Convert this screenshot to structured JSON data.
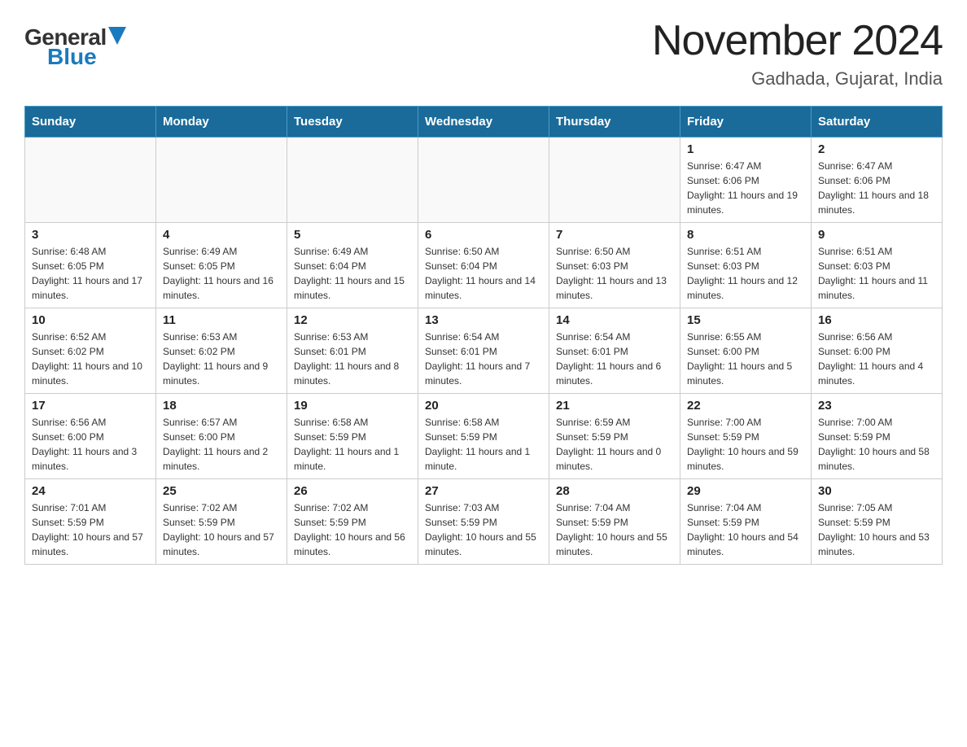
{
  "logo": {
    "general": "General",
    "blue": "Blue"
  },
  "title": "November 2024",
  "subtitle": "Gadhada, Gujarat, India",
  "weekdays": [
    "Sunday",
    "Monday",
    "Tuesday",
    "Wednesday",
    "Thursday",
    "Friday",
    "Saturday"
  ],
  "weeks": [
    [
      {
        "day": "",
        "info": ""
      },
      {
        "day": "",
        "info": ""
      },
      {
        "day": "",
        "info": ""
      },
      {
        "day": "",
        "info": ""
      },
      {
        "day": "",
        "info": ""
      },
      {
        "day": "1",
        "info": "Sunrise: 6:47 AM\nSunset: 6:06 PM\nDaylight: 11 hours and 19 minutes."
      },
      {
        "day": "2",
        "info": "Sunrise: 6:47 AM\nSunset: 6:06 PM\nDaylight: 11 hours and 18 minutes."
      }
    ],
    [
      {
        "day": "3",
        "info": "Sunrise: 6:48 AM\nSunset: 6:05 PM\nDaylight: 11 hours and 17 minutes."
      },
      {
        "day": "4",
        "info": "Sunrise: 6:49 AM\nSunset: 6:05 PM\nDaylight: 11 hours and 16 minutes."
      },
      {
        "day": "5",
        "info": "Sunrise: 6:49 AM\nSunset: 6:04 PM\nDaylight: 11 hours and 15 minutes."
      },
      {
        "day": "6",
        "info": "Sunrise: 6:50 AM\nSunset: 6:04 PM\nDaylight: 11 hours and 14 minutes."
      },
      {
        "day": "7",
        "info": "Sunrise: 6:50 AM\nSunset: 6:03 PM\nDaylight: 11 hours and 13 minutes."
      },
      {
        "day": "8",
        "info": "Sunrise: 6:51 AM\nSunset: 6:03 PM\nDaylight: 11 hours and 12 minutes."
      },
      {
        "day": "9",
        "info": "Sunrise: 6:51 AM\nSunset: 6:03 PM\nDaylight: 11 hours and 11 minutes."
      }
    ],
    [
      {
        "day": "10",
        "info": "Sunrise: 6:52 AM\nSunset: 6:02 PM\nDaylight: 11 hours and 10 minutes."
      },
      {
        "day": "11",
        "info": "Sunrise: 6:53 AM\nSunset: 6:02 PM\nDaylight: 11 hours and 9 minutes."
      },
      {
        "day": "12",
        "info": "Sunrise: 6:53 AM\nSunset: 6:01 PM\nDaylight: 11 hours and 8 minutes."
      },
      {
        "day": "13",
        "info": "Sunrise: 6:54 AM\nSunset: 6:01 PM\nDaylight: 11 hours and 7 minutes."
      },
      {
        "day": "14",
        "info": "Sunrise: 6:54 AM\nSunset: 6:01 PM\nDaylight: 11 hours and 6 minutes."
      },
      {
        "day": "15",
        "info": "Sunrise: 6:55 AM\nSunset: 6:00 PM\nDaylight: 11 hours and 5 minutes."
      },
      {
        "day": "16",
        "info": "Sunrise: 6:56 AM\nSunset: 6:00 PM\nDaylight: 11 hours and 4 minutes."
      }
    ],
    [
      {
        "day": "17",
        "info": "Sunrise: 6:56 AM\nSunset: 6:00 PM\nDaylight: 11 hours and 3 minutes."
      },
      {
        "day": "18",
        "info": "Sunrise: 6:57 AM\nSunset: 6:00 PM\nDaylight: 11 hours and 2 minutes."
      },
      {
        "day": "19",
        "info": "Sunrise: 6:58 AM\nSunset: 5:59 PM\nDaylight: 11 hours and 1 minute."
      },
      {
        "day": "20",
        "info": "Sunrise: 6:58 AM\nSunset: 5:59 PM\nDaylight: 11 hours and 1 minute."
      },
      {
        "day": "21",
        "info": "Sunrise: 6:59 AM\nSunset: 5:59 PM\nDaylight: 11 hours and 0 minutes."
      },
      {
        "day": "22",
        "info": "Sunrise: 7:00 AM\nSunset: 5:59 PM\nDaylight: 10 hours and 59 minutes."
      },
      {
        "day": "23",
        "info": "Sunrise: 7:00 AM\nSunset: 5:59 PM\nDaylight: 10 hours and 58 minutes."
      }
    ],
    [
      {
        "day": "24",
        "info": "Sunrise: 7:01 AM\nSunset: 5:59 PM\nDaylight: 10 hours and 57 minutes."
      },
      {
        "day": "25",
        "info": "Sunrise: 7:02 AM\nSunset: 5:59 PM\nDaylight: 10 hours and 57 minutes."
      },
      {
        "day": "26",
        "info": "Sunrise: 7:02 AM\nSunset: 5:59 PM\nDaylight: 10 hours and 56 minutes."
      },
      {
        "day": "27",
        "info": "Sunrise: 7:03 AM\nSunset: 5:59 PM\nDaylight: 10 hours and 55 minutes."
      },
      {
        "day": "28",
        "info": "Sunrise: 7:04 AM\nSunset: 5:59 PM\nDaylight: 10 hours and 55 minutes."
      },
      {
        "day": "29",
        "info": "Sunrise: 7:04 AM\nSunset: 5:59 PM\nDaylight: 10 hours and 54 minutes."
      },
      {
        "day": "30",
        "info": "Sunrise: 7:05 AM\nSunset: 5:59 PM\nDaylight: 10 hours and 53 minutes."
      }
    ]
  ]
}
